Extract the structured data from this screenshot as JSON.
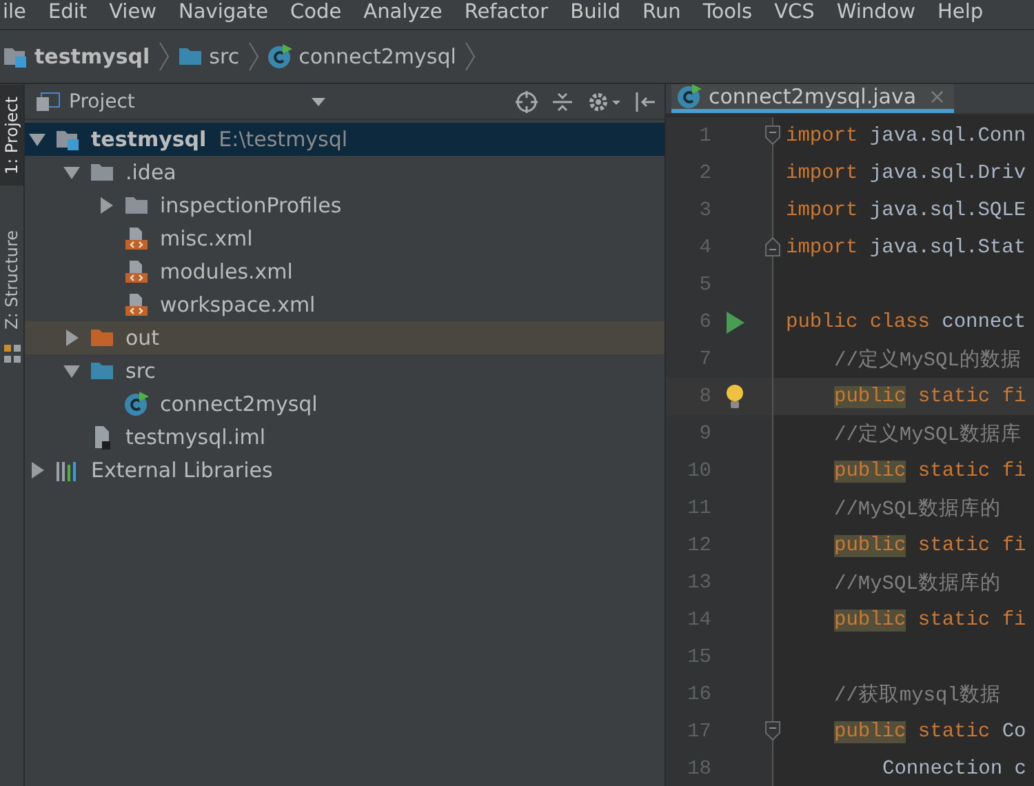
{
  "menu": [
    "ile",
    "Edit",
    "View",
    "Navigate",
    "Code",
    "Analyze",
    "Refactor",
    "Build",
    "Run",
    "Tools",
    "VCS",
    "Window",
    "Help"
  ],
  "breadcrumbs": [
    {
      "label": "testmysql",
      "kind": "project"
    },
    {
      "label": "src",
      "kind": "source-folder"
    },
    {
      "label": "connect2mysql",
      "kind": "java-class"
    }
  ],
  "side_tabs": [
    {
      "label": "1: Project",
      "selected": true
    },
    {
      "label": "Z: Structure",
      "selected": false
    }
  ],
  "project_panel": {
    "title": "Project",
    "tree": [
      {
        "label": "testmysql",
        "path": "E:\\testmysql",
        "kind": "project",
        "expanded": true,
        "selected": true,
        "hovered": false,
        "children": [
          {
            "label": ".idea",
            "kind": "folder",
            "expanded": true,
            "selected": false,
            "hovered": false,
            "children": [
              {
                "label": "inspectionProfiles",
                "kind": "folder",
                "expanded": false,
                "selected": false,
                "hovered": false
              },
              {
                "label": "misc.xml",
                "kind": "xml",
                "selected": false,
                "hovered": false
              },
              {
                "label": "modules.xml",
                "kind": "xml",
                "selected": false,
                "hovered": false
              },
              {
                "label": "workspace.xml",
                "kind": "xml",
                "selected": false,
                "hovered": false
              }
            ]
          },
          {
            "label": "out",
            "kind": "excluded-folder",
            "expanded": false,
            "selected": false,
            "hovered": true
          },
          {
            "label": "src",
            "kind": "source-folder",
            "expanded": true,
            "selected": false,
            "hovered": false,
            "children": [
              {
                "label": "connect2mysql",
                "kind": "java-class",
                "selected": false,
                "hovered": false
              }
            ]
          },
          {
            "label": "testmysql.iml",
            "kind": "iml",
            "selected": false,
            "hovered": false
          }
        ]
      },
      {
        "label": "External Libraries",
        "kind": "libraries",
        "expanded": false,
        "selected": false,
        "hovered": false
      }
    ]
  },
  "editor": {
    "tabs": [
      {
        "label": "connect2mysql.java",
        "close": "×",
        "selected": true
      }
    ],
    "lines": [
      {
        "number": "1",
        "kind": "top",
        "fold_start": true,
        "current": false,
        "tokens": [
          {
            "kind": "keyword",
            "text": "import"
          },
          {
            "kind": "plain",
            "text": " java.sql.Conn"
          }
        ]
      },
      {
        "number": "2",
        "kind": "top",
        "current": false,
        "tokens": [
          {
            "kind": "keyword",
            "text": "import"
          },
          {
            "kind": "plain",
            "text": " java.sql.Driv"
          }
        ]
      },
      {
        "number": "3",
        "kind": "top",
        "current": false,
        "tokens": [
          {
            "kind": "keyword",
            "text": "import"
          },
          {
            "kind": "plain",
            "text": " java.sql.SQLE"
          }
        ]
      },
      {
        "number": "4",
        "kind": "top",
        "fold_end": true,
        "current": false,
        "tokens": [
          {
            "kind": "keyword",
            "text": "import"
          },
          {
            "kind": "plain",
            "text": " java.sql.Stat"
          }
        ]
      },
      {
        "number": "5",
        "current": false
      },
      {
        "number": "6",
        "kind": "top",
        "run": true,
        "current": false,
        "tokens": [
          {
            "kind": "keyword",
            "text": "public class"
          },
          {
            "kind": "plain",
            "text": " connect"
          }
        ]
      },
      {
        "number": "7",
        "kind": "member",
        "current": false,
        "tokens": [
          {
            "kind": "comment",
            "text": "//定义MySQL的数据"
          }
        ]
      },
      {
        "number": "8",
        "kind": "member",
        "bulb": true,
        "current": true,
        "tokens": [
          {
            "kind": "marked-keyword",
            "text": "public"
          },
          {
            "kind": "keyword",
            "text": " static fi"
          }
        ]
      },
      {
        "number": "9",
        "kind": "member",
        "current": false,
        "tokens": [
          {
            "kind": "comment",
            "text": "//定义MySQL数据库"
          }
        ]
      },
      {
        "number": "10",
        "kind": "member",
        "current": false,
        "tokens": [
          {
            "kind": "marked-keyword",
            "text": "public"
          },
          {
            "kind": "keyword",
            "text": " static fi"
          }
        ]
      },
      {
        "number": "11",
        "kind": "member",
        "current": false,
        "tokens": [
          {
            "kind": "comment",
            "text": "//MySQL数据库的"
          }
        ]
      },
      {
        "number": "12",
        "kind": "member",
        "current": false,
        "tokens": [
          {
            "kind": "marked-keyword",
            "text": "public"
          },
          {
            "kind": "keyword",
            "text": " static fi"
          }
        ]
      },
      {
        "number": "13",
        "kind": "member",
        "current": false,
        "tokens": [
          {
            "kind": "comment",
            "text": "//MySQL数据库的"
          }
        ]
      },
      {
        "number": "14",
        "kind": "member",
        "current": false,
        "tokens": [
          {
            "kind": "marked-keyword",
            "text": "public"
          },
          {
            "kind": "keyword",
            "text": " static fi"
          }
        ]
      },
      {
        "number": "15",
        "current": false
      },
      {
        "number": "16",
        "kind": "member",
        "current": false,
        "tokens": [
          {
            "kind": "comment",
            "text": "//获取mysql数据"
          }
        ]
      },
      {
        "number": "17",
        "kind": "member",
        "fold_start": true,
        "current": false,
        "tokens": [
          {
            "kind": "marked-keyword",
            "text": "public"
          },
          {
            "kind": "keyword",
            "text": " static"
          },
          {
            "kind": "plain",
            "text": " Co"
          }
        ]
      },
      {
        "number": "18",
        "kind": "statement",
        "current": false,
        "tokens": [
          {
            "kind": "plain",
            "text": "Connection c"
          }
        ]
      }
    ]
  }
}
